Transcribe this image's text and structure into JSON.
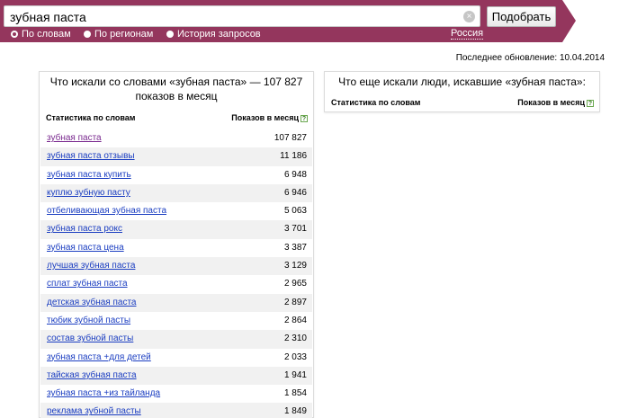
{
  "search": {
    "query": "зубная паста",
    "clear_symbol": "×",
    "submit_label": "Подобрать"
  },
  "modes": [
    {
      "label": "По словам",
      "selected": true
    },
    {
      "label": "По регионам",
      "selected": false
    },
    {
      "label": "История запросов",
      "selected": false
    }
  ],
  "region": "Россия",
  "last_update": "Последнее обновление: 10.04.2014",
  "colors": {
    "brand": "#94365d",
    "link": "#1a3dc1",
    "visited": "#7a2a8f"
  },
  "left_panel": {
    "title": "Что искали со словами «зубная паста» — 107 827 показов в месяц",
    "col_keywords": "Статистика по словам",
    "col_impressions": "Показов в месяц",
    "help_symbol": "?",
    "rows": [
      {
        "keyword": "зубная паста",
        "count": "107 827"
      },
      {
        "keyword": "зубная паста отзывы",
        "count": "11 186"
      },
      {
        "keyword": "зубная паста купить",
        "count": "6 948"
      },
      {
        "keyword": "куплю зубную пасту",
        "count": "6 946"
      },
      {
        "keyword": "отбеливающая зубная паста",
        "count": "5 063"
      },
      {
        "keyword": "зубная паста рокс",
        "count": "3 701"
      },
      {
        "keyword": "зубная паста цена",
        "count": "3 387"
      },
      {
        "keyword": "лучшая зубная паста",
        "count": "3 129"
      },
      {
        "keyword": "сплат зубная паста",
        "count": "2 965"
      },
      {
        "keyword": "детская зубная паста",
        "count": "2 897"
      },
      {
        "keyword": "тюбик зубной пасты",
        "count": "2 864"
      },
      {
        "keyword": "состав зубной пасты",
        "count": "2 310"
      },
      {
        "keyword": "зубная паста +для детей",
        "count": "2 033"
      },
      {
        "keyword": "тайская зубная паста",
        "count": "1 941"
      },
      {
        "keyword": "зубная паста +из тайланда",
        "count": "1 854"
      },
      {
        "keyword": "реклама зубной пасты",
        "count": "1 849"
      }
    ]
  },
  "right_panel": {
    "title": "Что еще искали люди, искавшие «зубная паста»:",
    "col_keywords": "Статистика по словам",
    "col_impressions": "Показов в месяц",
    "help_symbol": "?"
  }
}
